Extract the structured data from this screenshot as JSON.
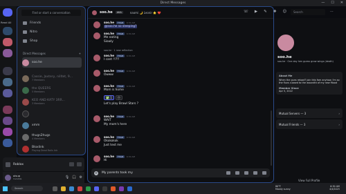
{
  "window": {
    "title": "Direct Messages",
    "controls": [
      "—",
      "☐",
      "✕"
    ]
  },
  "rail": {
    "read_all": "Read All"
  },
  "dm_panel": {
    "search_placeholder": "Find or start a conversation",
    "nav": [
      {
        "label": "Friends",
        "icon": "friends-icon"
      },
      {
        "label": "Nitro",
        "icon": "nitro-icon"
      },
      {
        "label": "Shop",
        "icon": "shop-icon"
      }
    ],
    "dm_header": "Direct Messages",
    "dm_add": "+",
    "conversations": [
      {
        "name": "soo.he",
        "sub": "",
        "active": true,
        "color": "#c98aa0"
      },
      {
        "name": "Cassie, Jaxtery, nilltet, 9...",
        "sub": "7 Members",
        "active": false,
        "color": "#7a6a5a"
      },
      {
        "name": "the QUEERS",
        "sub": "5 Members",
        "active": false,
        "color": "#3a6a4a"
      },
      {
        "name": "KEO AND KATY 3RR...",
        "sub": "3 Members",
        "active": false,
        "color": "#9a4a4a"
      },
      {
        "name": "",
        "sub": "",
        "active": false,
        "color": "#2a2a2e"
      },
      {
        "name": "xmm",
        "sub": "",
        "active": false,
        "color": "#4a7a9a"
      },
      {
        "name": "thugs2hugs",
        "sub": "4 Members",
        "active": false,
        "color": "#6a6a6a"
      },
      {
        "name": "Bloxlink",
        "sub": "Playing Dead Rails 4dr",
        "active": false,
        "color": "#b03030"
      }
    ]
  },
  "activity": {
    "game": "Roblox"
  },
  "user": {
    "name": "olsup",
    "status": "Invisible"
  },
  "chat": {
    "title": "soo.he",
    "tag": "AKA",
    "subtitle": "naomi 🌙 Leonir 🌟 ❤️",
    "messages": [
      {
        "author": "soo.he",
        "tag": "✝MLB",
        "time": "6:30 AM",
        "lines": [
          "@soo.he so sleeping?"
        ],
        "mention": true
      },
      {
        "author": "soo.he",
        "tag": "✝MLB",
        "time": "6:30 AM",
        "lines": [
          "Me eating",
          "Siowly"
        ]
      },
      {
        "system": "soo.he · 1 new reflection"
      },
      {
        "author": "soo.he",
        "tag": "✝MLB",
        "time": "6:30 AM",
        "lines": [
          "I cant !!?!!"
        ]
      },
      {
        "author": "soo.he",
        "tag": "✝MLB",
        "time": "6:30 AM",
        "lines": [
          "Owww"
        ]
      },
      {
        "author": "soo.he",
        "tag": "✝MLB",
        "time": "6:30 AM",
        "lines": [
          "Mom is home"
        ]
      },
      {
        "reactions": [
          "✅ 1",
          "😶"
        ]
      },
      {
        "lines_only": [
          "Let's play Brawl Stars ?"
        ]
      },
      {
        "author": "soo.he",
        "tag": "✝MLB",
        "time": "6:30 AM",
        "lines": [
          "WAIT",
          "My mom's here"
        ]
      },
      {
        "author": "soo.he",
        "tag": "✝MLB",
        "time": "6:30 AM",
        "lines": [
          "Okokokok",
          "Just text me"
        ]
      },
      {
        "author": "soo.he",
        "tag": "✝MLB",
        "time": "6:30 AM",
        "lines": [
          "Hi"
        ]
      }
    ],
    "input_value": "My parents took my"
  },
  "header": {
    "search_placeholder": "Search",
    "more": "⋯"
  },
  "profile": {
    "name": "soo.he",
    "bio": "soo.he · One day hen guess grow wings (death)",
    "about_title": "About Me",
    "about_text": "When the guns reload? join this fam anyhow. I'm so the fluvs cuased to the woundth of my new Mood",
    "member_title": "Member Since",
    "member_date": "Apr 5, 2022",
    "mutual_servers": "Mutual Servers — 3",
    "mutual_friends": "Mutual Friends — 3",
    "view_full": "View Full Profile"
  },
  "taskbar": {
    "search": "Search",
    "weather": "80°F",
    "weather_sub": "Mostly sunny",
    "time": "6:30 AM",
    "date": "4/4/2025"
  }
}
